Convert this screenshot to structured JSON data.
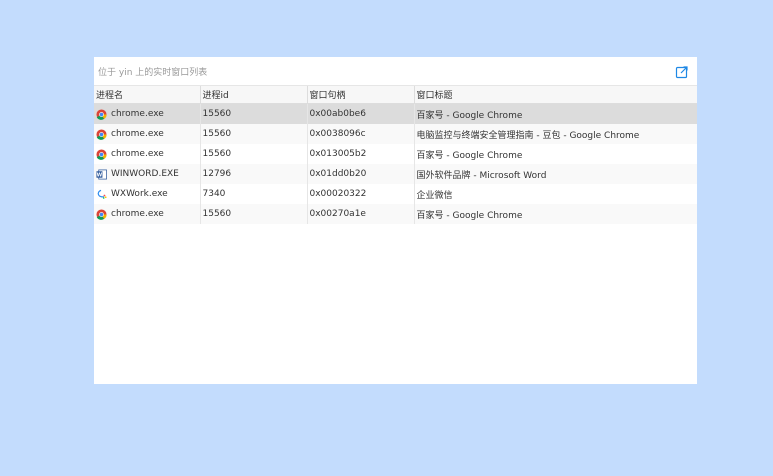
{
  "panel": {
    "title": "位于 yin 上的实时窗口列表",
    "export_icon": "export-icon"
  },
  "table": {
    "headers": [
      "进程名",
      "进程id",
      "窗口句柄",
      "窗口标题"
    ],
    "rows": [
      {
        "icon": "chrome-icon",
        "process": "chrome.exe",
        "pid": "15560",
        "handle": "0x00ab0be6",
        "title": "百家号 - Google Chrome",
        "selected": true
      },
      {
        "icon": "chrome-icon",
        "process": "chrome.exe",
        "pid": "15560",
        "handle": "0x0038096c",
        "title": "电脑监控与终端安全管理指南 - 豆包 - Google Chrome",
        "selected": false
      },
      {
        "icon": "chrome-icon",
        "process": "chrome.exe",
        "pid": "15560",
        "handle": "0x013005b2",
        "title": "百家号 - Google Chrome",
        "selected": false
      },
      {
        "icon": "word-icon",
        "process": "WINWORD.EXE",
        "pid": "12796",
        "handle": "0x01dd0b20",
        "title": "国外软件品牌 - Microsoft Word",
        "selected": false
      },
      {
        "icon": "wxwork-icon",
        "process": "WXWork.exe",
        "pid": "7340",
        "handle": "0x00020322",
        "title": "企业微信",
        "selected": false
      },
      {
        "icon": "chrome-icon",
        "process": "chrome.exe",
        "pid": "15560",
        "handle": "0x00270a1e",
        "title": "百家号 - Google Chrome",
        "selected": false
      }
    ]
  },
  "colors": {
    "background": "#c3dcfd",
    "accent": "#1e88e5",
    "selected_row": "#dcdcdc"
  }
}
